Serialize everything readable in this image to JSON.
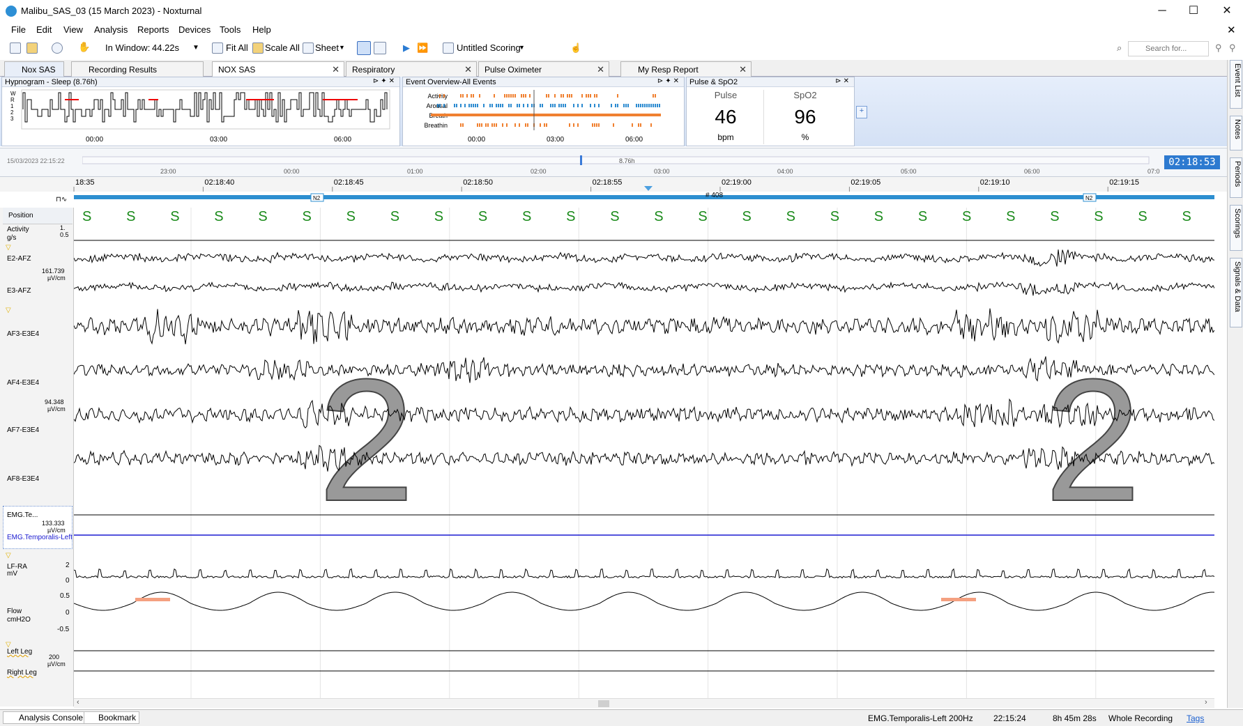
{
  "window": {
    "title": "Malibu_SAS_03 (15 March 2023)  - Noxturnal"
  },
  "menu": [
    "File",
    "Edit",
    "View",
    "Analysis",
    "Reports",
    "Devices",
    "Tools",
    "Help"
  ],
  "toolbar": {
    "in_window_label": "In Window:",
    "in_window_value": "44.22s",
    "fit_all": "Fit All",
    "scale_all": "Scale All",
    "sheet": "Sheet",
    "scoring": "Untitled Scoring",
    "search_placeholder": "Search for..."
  },
  "tabs": [
    {
      "label": "Nox SAS"
    },
    {
      "label": "Recording Results"
    },
    {
      "label": "NOX SAS"
    },
    {
      "label": "Respiratory"
    },
    {
      "label": "Pulse Oximeter"
    },
    {
      "label": "My Resp Report"
    }
  ],
  "hypnogram": {
    "title": "Hypnogram - Sleep (8.76h)",
    "stages": [
      "W",
      "R",
      "1",
      "2",
      "3"
    ],
    "ticks": [
      "00:00",
      "03:00",
      "06:00"
    ]
  },
  "events": {
    "title": "Event Overview-All Events",
    "rows": [
      "Activity",
      "Arousal",
      "Breath",
      "Breathin"
    ],
    "ticks": [
      "00:00",
      "03:00",
      "06:00"
    ]
  },
  "pulse_spo2": {
    "title": "Pulse & SpO2",
    "pulse_label": "Pulse",
    "pulse_value": "46",
    "pulse_unit": "bpm",
    "spo2_label": "SpO2",
    "spo2_value": "96",
    "spo2_unit": "%"
  },
  "timeline": {
    "start": "15/03/2023 22:15:22",
    "duration": "8.76h",
    "clock": "02:18:53",
    "ticks": [
      "23:00",
      "00:00",
      "01:00",
      "02:00",
      "03:00",
      "04:00",
      "05:00",
      "06:00",
      "07:0"
    ]
  },
  "time_axis": {
    "ticks": [
      "18:35",
      "02:18:40",
      "02:18:45",
      "02:18:50",
      "02:18:55",
      "02:19:00",
      "02:19:05",
      "02:19:10",
      "02:19:15"
    ]
  },
  "epoch": {
    "left_stage": "N2",
    "right_stage": "N2",
    "epoch_num": "# 408",
    "big_stage": "2"
  },
  "position": {
    "label": "Position",
    "marker": "S",
    "count": 26
  },
  "channels": {
    "activity": {
      "name": "Activity",
      "unit": "g/s",
      "s1": "1.",
      "s2": "0.5"
    },
    "e2": "E2-AFZ",
    "e2_scale": "161.739",
    "uvcm": "µV/cm",
    "e3": "E3-AFZ",
    "af3": "AF3-E3E4",
    "af4": "AF4-E3E4",
    "af_scale": "94.348",
    "af7": "AF7-E3E4",
    "af8": "AF8-E3E4",
    "emg": "EMG.Te...",
    "emg_scale": "133.333",
    "emg_full": "EMG.Temporalis-Left",
    "ecg": "LF-RA",
    "ecg_unit": "mV",
    "ecg_t": "2",
    "ecg_b": "0",
    "flow": "Flow",
    "flow_unit": "cmH2O",
    "flow_t": "0.5",
    "flow_m": "0",
    "flow_b": "-0.5",
    "left_leg": "Left Leg",
    "leg_scale": "200",
    "right_leg": "Right Leg"
  },
  "right_rail": [
    "Event List",
    "Notes",
    "Periods",
    "Scorings",
    "Signals & Data"
  ],
  "status": {
    "console": "Analysis Console",
    "bookmark": "Bookmark",
    "signal": "EMG.Temporalis-Left 200Hz",
    "time": "22:15:24",
    "duration": "8h 45m 28s",
    "range": "Whole Recording",
    "tags": "Tags"
  }
}
